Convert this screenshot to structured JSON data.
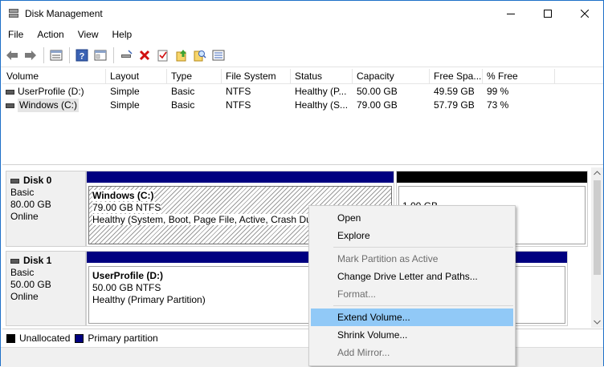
{
  "window": {
    "title": "Disk Management"
  },
  "menu": [
    "File",
    "Action",
    "View",
    "Help"
  ],
  "volume_list": {
    "columns": [
      "Volume",
      "Layout",
      "Type",
      "File System",
      "Status",
      "Capacity",
      "Free Spa...",
      "% Free"
    ],
    "rows": [
      [
        "UserProfile (D:)",
        "Simple",
        "Basic",
        "NTFS",
        "Healthy (P...",
        "50.00 GB",
        "49.59 GB",
        "99 %"
      ],
      [
        "Windows (C:)",
        "Simple",
        "Basic",
        "NTFS",
        "Healthy (S...",
        "79.00 GB",
        "57.79 GB",
        "73 %"
      ]
    ]
  },
  "disks": [
    {
      "name": "Disk 0",
      "type": "Basic",
      "size": "80.00 GB",
      "state": "Online",
      "partitions": [
        {
          "title": "Windows  (C:)",
          "size": "79.00 GB NTFS",
          "status": "Healthy (System, Boot, Page File, Active, Crash Dum"
        },
        {
          "title": "",
          "size": "1.00 GB",
          "status": ""
        }
      ]
    },
    {
      "name": "Disk 1",
      "type": "Basic",
      "size": "50.00 GB",
      "state": "Online",
      "partitions": [
        {
          "title": "UserProfile  (D:)",
          "size": "50.00 GB NTFS",
          "status": "Healthy (Primary Partition)"
        }
      ]
    }
  ],
  "legend": {
    "unallocated": "Unallocated",
    "primary": "Primary partition"
  },
  "context_menu": {
    "items": [
      {
        "label": "Open",
        "enabled": true
      },
      {
        "label": "Explore",
        "enabled": true
      },
      {
        "label": "Mark Partition as Active",
        "enabled": false
      },
      {
        "label": "Change Drive Letter and Paths...",
        "enabled": true
      },
      {
        "label": "Format...",
        "enabled": false
      },
      {
        "label": "Extend Volume...",
        "enabled": true,
        "highlighted": true
      },
      {
        "label": "Shrink Volume...",
        "enabled": true
      },
      {
        "label": "Add Mirror...",
        "enabled": false
      }
    ]
  },
  "colors": {
    "primary_partition": "#000080",
    "unallocated": "#000000",
    "menu_highlight": "#91c9f7",
    "accent_border": "#1e70c8"
  },
  "icons": [
    "back-icon",
    "forward-icon",
    "properties-icon",
    "help-icon",
    "console-icon",
    "connect-icon",
    "delete-icon",
    "check-icon",
    "up-arrow-icon",
    "search-icon",
    "list-icon"
  ]
}
